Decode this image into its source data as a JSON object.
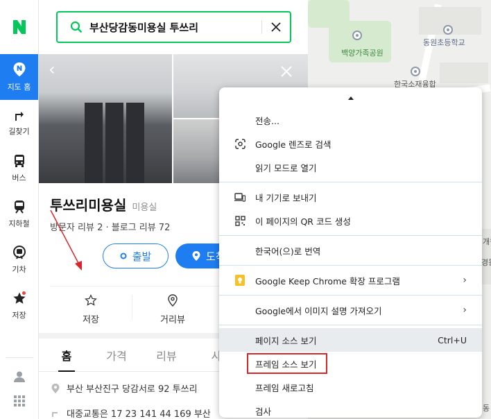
{
  "map": {
    "labels": {
      "park": "백양가족공원",
      "school": "동원초등학교",
      "union": "한국소재융합",
      "edge1": "개원",
      "edge2": "경동",
      "edge3": "동"
    }
  },
  "nav": {
    "items": [
      {
        "label": "지도 홈",
        "icon": "naver-map-icon"
      },
      {
        "label": "길찾기",
        "icon": "directions-icon"
      },
      {
        "label": "버스",
        "icon": "bus-icon"
      },
      {
        "label": "지하철",
        "icon": "subway-icon"
      },
      {
        "label": "기차",
        "icon": "train-icon"
      },
      {
        "label": "저장",
        "icon": "star-icon"
      }
    ]
  },
  "search": {
    "query": "부산당감동미용실 투쓰리"
  },
  "place": {
    "name": "투쓰리미용실",
    "category": "미용실",
    "reviews": "방문자 리뷰 2 · 블로그 리뷰 72",
    "start_label": "출발",
    "arrive_label": "도착",
    "actions": [
      {
        "label": "저장",
        "icon": "star-outline-icon"
      },
      {
        "label": "거리뷰",
        "icon": "location-outline-icon"
      }
    ],
    "tabs": [
      "홈",
      "가격",
      "리뷰",
      "사"
    ],
    "address": "부산 부산진구 당감서로 92 투쓰리",
    "transit": "대중교통은 17 23 141 44 169 부산"
  },
  "context_menu": {
    "groups": [
      [
        {
          "label": "전송...",
          "icon": ""
        },
        {
          "label": "Google 렌즈로 검색",
          "icon": "lens-icon"
        },
        {
          "label": "읽기 모드로 열기",
          "icon": ""
        }
      ],
      [
        {
          "label": "내 기기로 보내기",
          "icon": "devices-icon"
        },
        {
          "label": "이 페이지의 QR 코드 생성",
          "icon": "qr-icon"
        }
      ],
      [
        {
          "label": "한국어(으)로 번역",
          "icon": ""
        }
      ],
      [
        {
          "label": "Google Keep Chrome 확장 프로그램",
          "icon": "keep-icon",
          "submenu": "›"
        }
      ],
      [
        {
          "label": "Google에서 이미지 설명 가져오기",
          "icon": "",
          "submenu": "›"
        }
      ],
      [
        {
          "label": "페이지 소스 보기",
          "shortcut": "Ctrl+U"
        },
        {
          "label": "프레임 소스 보기"
        },
        {
          "label": "프레임 새로고침"
        },
        {
          "label": "검사"
        }
      ]
    ]
  },
  "colors": {
    "naver_green": "#03c75a",
    "accent_blue": "#1e7df0",
    "annotation_red": "#d9262b"
  }
}
